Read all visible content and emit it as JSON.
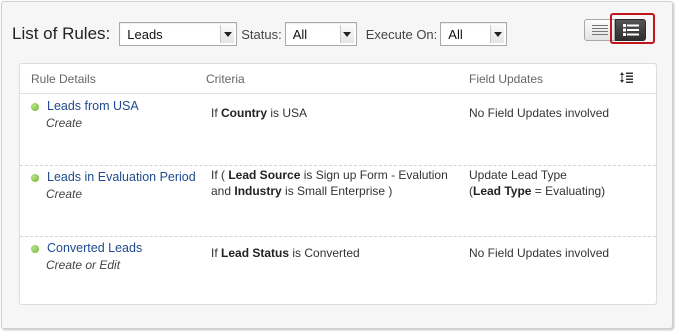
{
  "toolbar": {
    "title": "List of Rules:",
    "module_value": "Leads",
    "status_label": "Status:",
    "status_value": "All",
    "execute_label": "Execute On:",
    "execute_value": "All"
  },
  "view_toggle": {
    "list_icon": "list-view-icon",
    "detail_icon": "detail-view-icon"
  },
  "table": {
    "headers": {
      "rule": "Rule Details",
      "criteria": "Criteria",
      "updates": "Field Updates"
    },
    "sort_icon": "sort-order-icon",
    "rows": [
      {
        "name": "Leads from USA",
        "trigger": "Create",
        "criteria": [
          {
            "pre": "If ",
            "field": "Country",
            "post": " is USA"
          }
        ],
        "updates": [
          "No Field Updates involved"
        ]
      },
      {
        "name": "Leads in Evaluation Period",
        "trigger": "Create",
        "criteria": [
          {
            "pre": "If ( ",
            "field": "Lead Source",
            "post": " is Sign up Form - Evalution"
          },
          {
            "pre": "and ",
            "field": "Industry",
            "post": " is Small Enterprise )"
          }
        ],
        "updates": [
          "Update Lead Type",
          "(",
          "Lead Type",
          " = Evaluating)"
        ]
      },
      {
        "name": "Converted Leads",
        "trigger": "Create or Edit",
        "criteria": [
          {
            "pre": "If ",
            "field": "Lead Status",
            "post": " is Converted"
          }
        ],
        "updates": [
          "No Field Updates involved"
        ]
      }
    ]
  },
  "colors": {
    "link": "#1f4b8e",
    "status_dot": "#6fb52e",
    "highlight": "#c0151b"
  }
}
